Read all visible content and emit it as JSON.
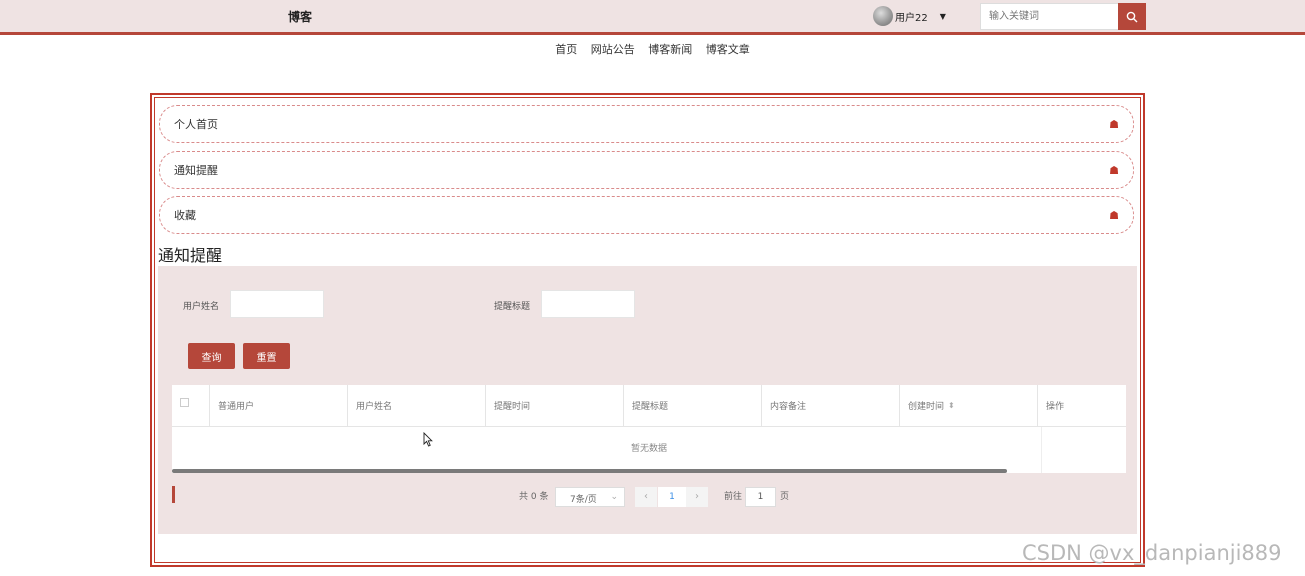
{
  "header": {
    "brand": "博客",
    "user_name": "用户22",
    "search_placeholder": "输入关键词"
  },
  "nav": [
    "首页",
    "网站公告",
    "博客新闻",
    "博客文章"
  ],
  "sidebar": {
    "items": [
      {
        "label": "个人首页"
      },
      {
        "label": "通知提醒"
      },
      {
        "label": "收藏"
      }
    ]
  },
  "section_title": "通知提醒",
  "filters": {
    "user_label": "用户姓名",
    "title_label": "提醒标题",
    "query_button": "查询",
    "reset_button": "重置"
  },
  "table": {
    "columns": [
      "普通用户",
      "用户姓名",
      "提醒时间",
      "提醒标题",
      "内容备注",
      "创建时间",
      "操作"
    ],
    "empty_text": "暂无数据"
  },
  "pagination": {
    "total": "共 0 条",
    "page_size": "7条/页",
    "current_page": "1",
    "goto_label": "前往",
    "goto_value": "1",
    "page_suffix": "页"
  },
  "watermark": "CSDN @vx_danpianji889"
}
